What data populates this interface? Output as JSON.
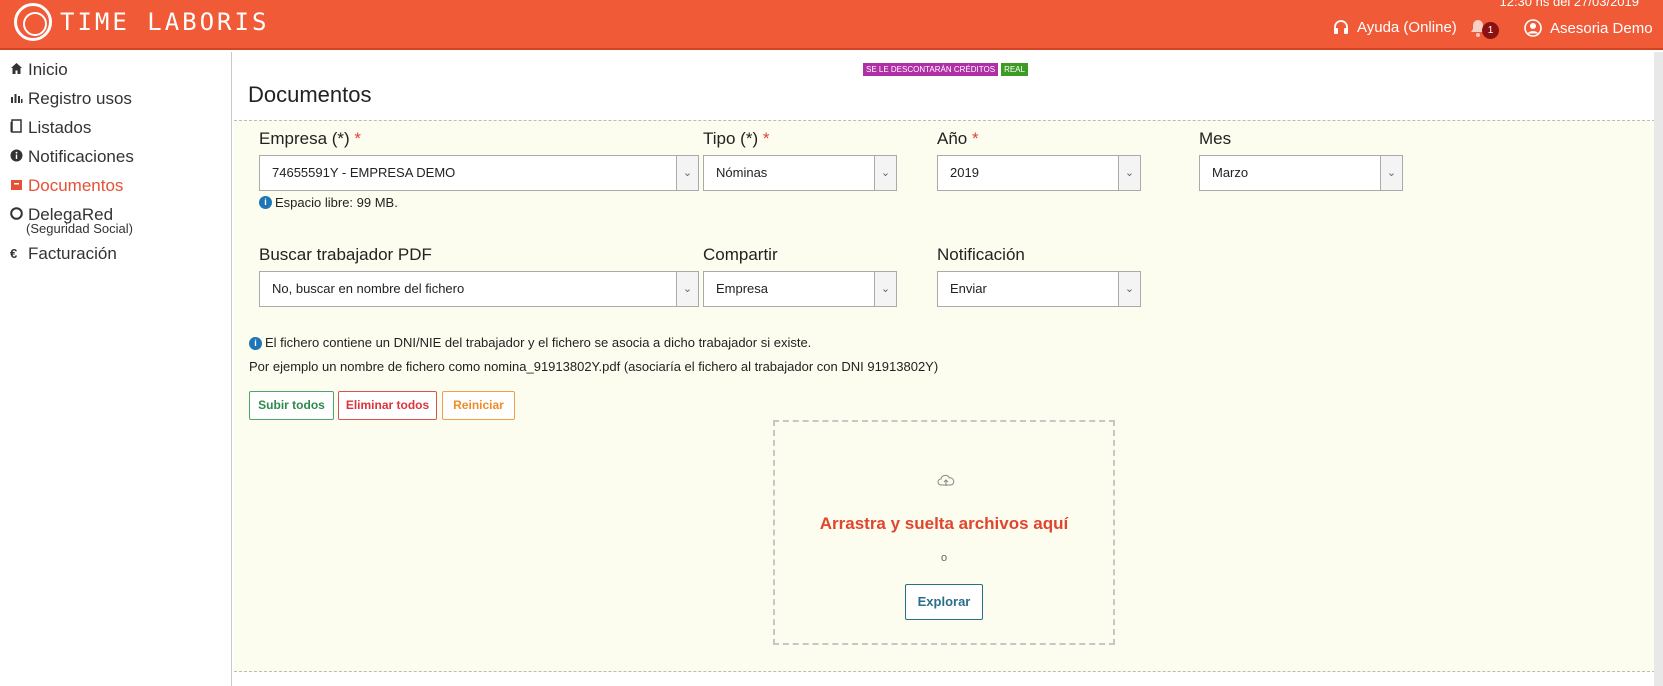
{
  "header": {
    "logo_text": "TIME LABORIS",
    "datetime": "12:30 hs del 27/03/2019",
    "help_label": "Ayuda (Online)",
    "notifications_count": "1",
    "user_label": "Asesoria Demo"
  },
  "sidebar": {
    "items": [
      {
        "label": "Inicio",
        "icon": "home-icon"
      },
      {
        "label": "Registro usos",
        "icon": "bar-chart-icon"
      },
      {
        "label": "Listados",
        "icon": "document-icon"
      },
      {
        "label": "Notificaciones",
        "icon": "info-icon"
      },
      {
        "label": "Documentos",
        "icon": "archive-icon",
        "active": true
      },
      {
        "label": "DelegaRed",
        "icon": "circle-icon",
        "sub": "(Seguridad Social)"
      },
      {
        "label": "Facturación",
        "icon": "euro-icon"
      }
    ]
  },
  "badges": {
    "credits": "SE LE DESCONTARÁN CRÉDITOS",
    "real": "REAL"
  },
  "page": {
    "title": "Documentos"
  },
  "form": {
    "empresa": {
      "label": "Empresa (*)",
      "required_mark": "*",
      "value": "74655591Y - EMPRESA DEMO"
    },
    "tipo": {
      "label": "Tipo (*)",
      "required_mark": "*",
      "value": "Nóminas"
    },
    "anio": {
      "label": "Año",
      "required_mark": "*",
      "value": "2019"
    },
    "mes": {
      "label": "Mes",
      "value": "Marzo"
    },
    "space_info": "Espacio libre: 99 MB.",
    "buscar": {
      "label": "Buscar trabajador PDF",
      "value": "No, buscar en nombre del fichero"
    },
    "compartir": {
      "label": "Compartir",
      "value": "Empresa"
    },
    "notificacion": {
      "label": "Notificación",
      "value": "Enviar"
    },
    "info_line1": "El fichero contiene un DNI/NIE del trabajador y el fichero se asocia a dicho trabajador si existe.",
    "info_line2": "Por ejemplo un nombre de fichero como nomina_91913802Y.pdf (asociaría el fichero al trabajador con DNI 91913802Y)"
  },
  "actions": {
    "upload_all": "Subir todos",
    "delete_all": "Eliminar todos",
    "reset": "Reiniciar"
  },
  "dropzone": {
    "text": "Arrastra y suelta archivos aquí",
    "or": "o",
    "browse": "Explorar"
  },
  "colors": {
    "brand": "#f15a37",
    "panel_bg": "#fdfdef",
    "active_nav": "#e45136"
  }
}
